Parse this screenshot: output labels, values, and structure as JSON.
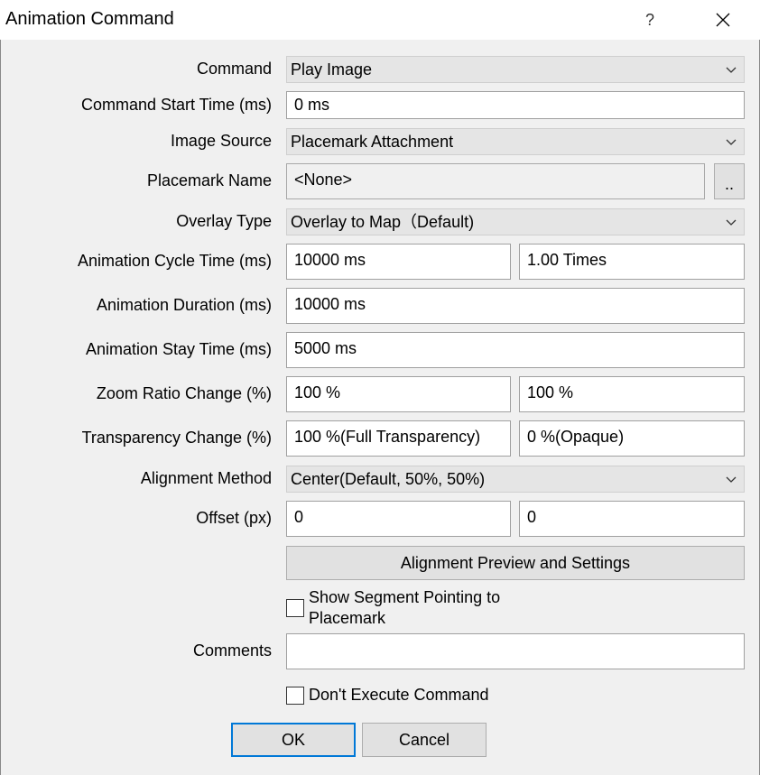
{
  "window": {
    "title": "Animation Command",
    "help_glyph": "?"
  },
  "form": {
    "command": {
      "label": "Command",
      "value": "Play Image"
    },
    "start_time": {
      "label": "Command Start Time (ms)",
      "value": "0 ms"
    },
    "image_source": {
      "label": "Image Source",
      "value": "Placemark Attachment"
    },
    "placemark_name": {
      "label": "Placemark Name",
      "value": "<None>",
      "browse_label": ".."
    },
    "overlay_type": {
      "label": "Overlay Type",
      "value": "Overlay to Map（Default)"
    },
    "cycle_time": {
      "label": "Animation Cycle Time (ms)",
      "value": "10000 ms",
      "times": "1.00 Times"
    },
    "duration": {
      "label": "Animation Duration (ms)",
      "value": "10000 ms"
    },
    "stay_time": {
      "label": "Animation Stay Time (ms)",
      "value": "5000 ms"
    },
    "zoom_ratio": {
      "label": "Zoom Ratio Change (%)",
      "start": "100 %",
      "end": "100 %"
    },
    "transparency": {
      "label": "Transparency Change (%)",
      "start": "100 %(Full Transparency)",
      "end": "0 %(Opaque)"
    },
    "alignment": {
      "label": "Alignment Method",
      "value": "Center(Default, 50%, 50%)"
    },
    "offset": {
      "label": "Offset (px)",
      "x": "0",
      "y": "0"
    },
    "alignment_preview_label": "Alignment Preview and Settings",
    "show_segment": {
      "label_line1": "Show Segment Pointing to",
      "label_line2": "Placemark",
      "checked": false
    },
    "comments": {
      "label": "Comments",
      "value": ""
    },
    "dont_execute": {
      "label": "Don't Execute Command",
      "checked": false
    }
  },
  "footer": {
    "ok_label": "OK",
    "cancel_label": "Cancel"
  },
  "colors": {
    "accent": "#0078d7",
    "combo_bg": "#e5e5e5",
    "button_bg": "#e1e1e1"
  }
}
